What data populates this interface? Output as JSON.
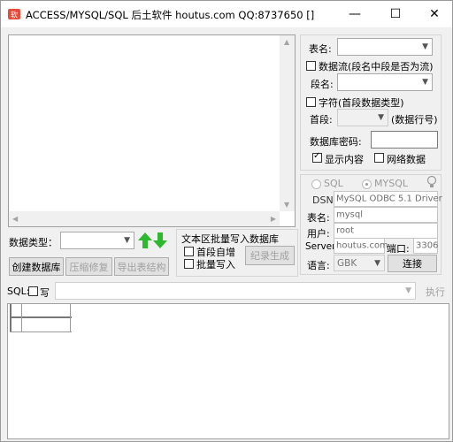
{
  "window": {
    "title": "ACCESS/MYSQL/SQL 后土软件 houtus.com QQ:8737650 []",
    "minimize": "—",
    "maximize": "☐",
    "close": "✕"
  },
  "left": {
    "data_type_label": "数据类型：",
    "data_type_value": "",
    "create_db": "创建数据库",
    "compact_repair": "压缩修复",
    "export_schema": "导出表结构",
    "batch_title": "文本区批量写入数据库",
    "auto_increment": "首段自增",
    "batch_write": "批量写入",
    "record_generate": "纪录生成"
  },
  "right": {
    "table_name_label": "表名:",
    "stream_label": "数据流(段名中段是否为流)",
    "field_name_label": "段名:",
    "chars_label": "字符(首段数据类型)",
    "first_field_label": "首段:",
    "row_number_label": "(数据行号)",
    "db_password_label": "数据库密码:",
    "show_content": "显示内容",
    "network_data": "网络数据",
    "show_content_checked": true,
    "network_data_checked": false,
    "sql_radio": "SQL",
    "mysql_radio": "MYSQL",
    "dsn_label": "DSN:",
    "dsn_value": "MySQL ODBC 5.1 Driver",
    "tablename2_label": "表名:",
    "tablename2_value": "mysql",
    "user_label": "用户:",
    "user_value": "root",
    "server_label": "Server:",
    "server_value": "houtus.com",
    "port_label": "端口:",
    "port_value": "3306",
    "lang_label": "语言:",
    "lang_value": "GBK",
    "connect": "连接"
  },
  "sql": {
    "label": "SQL:",
    "write_label": "写",
    "execute": "执行"
  },
  "colors": {
    "up_arrow": "#2db82d",
    "down_arrow": "#2db82d"
  }
}
